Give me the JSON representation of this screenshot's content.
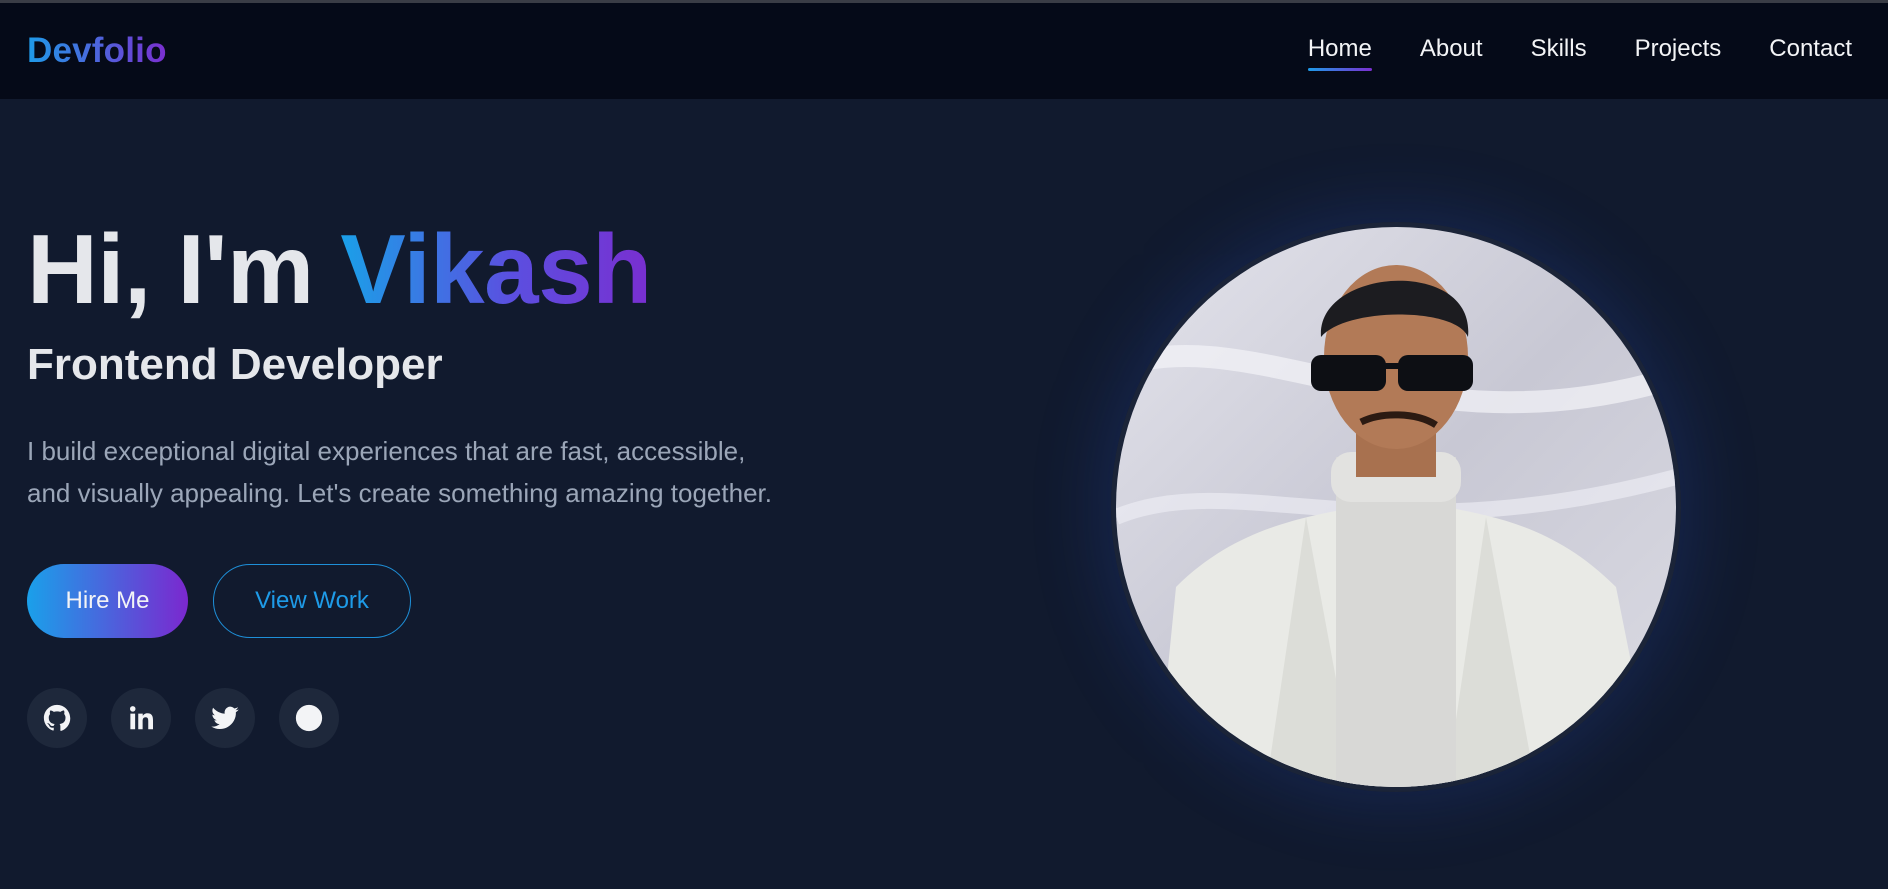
{
  "header": {
    "logo": "Devfolio",
    "nav": [
      {
        "label": "Home",
        "active": true
      },
      {
        "label": "About"
      },
      {
        "label": "Skills"
      },
      {
        "label": "Projects"
      },
      {
        "label": "Contact"
      }
    ]
  },
  "hero": {
    "greeting": "Hi, I'm ",
    "name": "Vikash",
    "subtitle": "Frontend Developer",
    "description": "I build exceptional digital experiences that are fast, accessible, and visually appealing. Let's create something amazing together.",
    "primary_button": "Hire Me",
    "secondary_button": "View Work"
  },
  "socials": [
    "github-icon",
    "linkedin-icon",
    "twitter-icon",
    "dribbble-icon"
  ],
  "colors": {
    "background": "#111a2e",
    "header": "#050a18",
    "accent_start": "#1e9be8",
    "accent_end": "#7b2fd0",
    "muted_text": "#9ba6b8"
  }
}
